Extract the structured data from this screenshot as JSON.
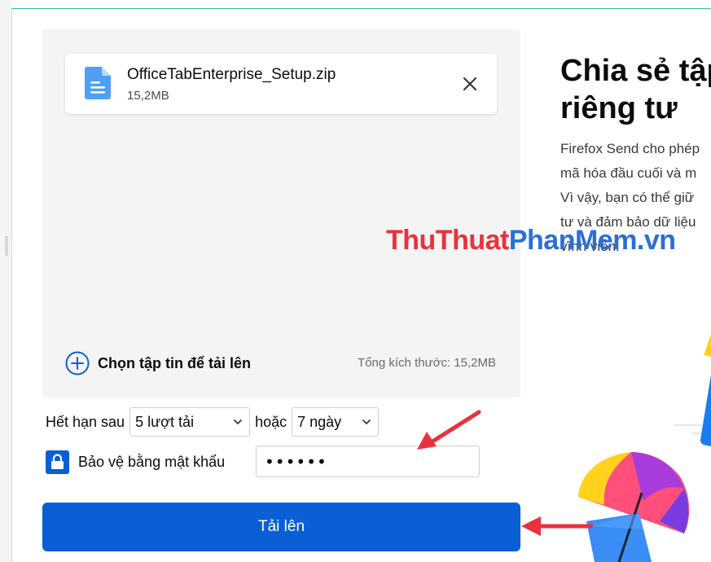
{
  "file": {
    "name": "OfficeTabEnterprise_Setup.zip",
    "size": "15,2MB"
  },
  "upload_area": {
    "add_label": "Chọn tập tin để tải lên",
    "total_size": "Tổng kích thước: 15,2MB"
  },
  "expiry": {
    "prefix": "Hết hạn sau",
    "downloads_value": "5 lượt tải",
    "or_label": "hoặc",
    "days_value": "7 ngày"
  },
  "password": {
    "label": "Bảo vệ bằng mật khẩu",
    "value": "••••••",
    "checked": true
  },
  "upload_button": {
    "label": "Tải lên"
  },
  "right_panel": {
    "headline_line1": "Chia sẻ tập",
    "headline_line2": "riêng tư",
    "desc_lines": [
      "Firefox Send cho phép",
      "mã hóa đầu cuối và m",
      "Vì vậy, bạn có thể giữ",
      "tư và đảm bảo dữ liệu",
      "vĩnh viễn."
    ]
  },
  "watermark": {
    "part1": "ThuThuat",
    "part2": "PhanMem.vn"
  },
  "colors": {
    "accent": "#0a5fd6",
    "panel_bg": "#f4f4f5",
    "arrow": "#e8323c",
    "file_icon": "#4e9ff5"
  }
}
